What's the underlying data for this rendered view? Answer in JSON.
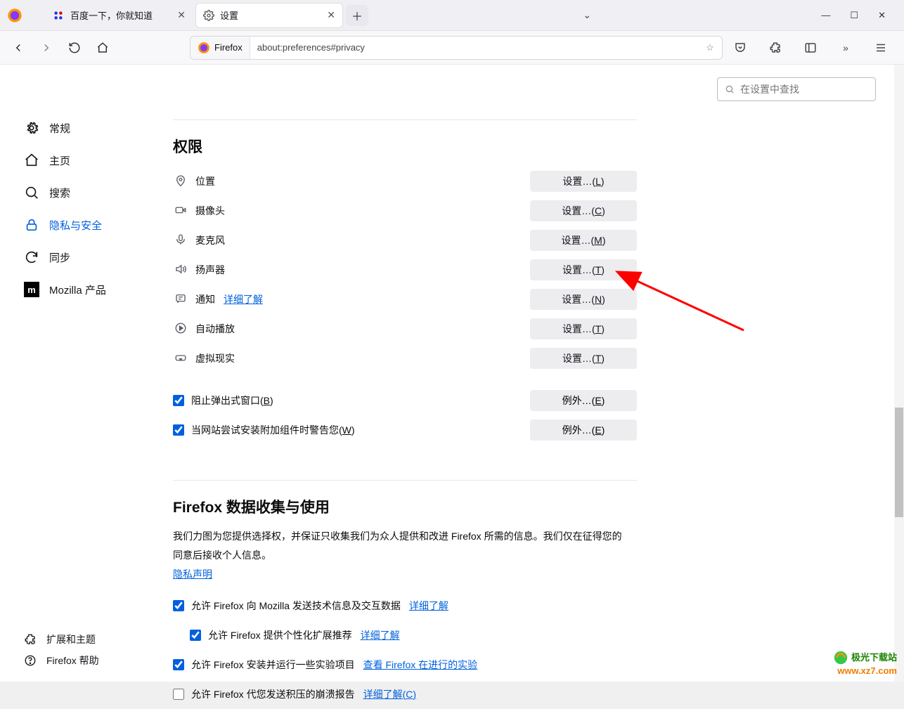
{
  "tabs": {
    "tab0": {
      "label": "百度一下，你就知道"
    },
    "tab1": {
      "label": "设置"
    }
  },
  "urlbar": {
    "chip": "Firefox",
    "url": "about:preferences#privacy"
  },
  "search": {
    "placeholder": "在设置中查找"
  },
  "sidebar": {
    "general": "常规",
    "home": "主页",
    "search": "搜索",
    "privacy": "隐私与安全",
    "sync": "同步",
    "mozilla": "Mozilla 产品",
    "extensions": "扩展和主题",
    "help": "Firefox 帮助"
  },
  "permissions": {
    "title": "权限",
    "location": "位置",
    "camera": "摄像头",
    "microphone": "麦克风",
    "speaker": "扬声器",
    "notifications": "通知",
    "autoplay": "自动播放",
    "vr": "虚拟现实",
    "learn_more": "详细了解",
    "btn_prefix": "设置…(",
    "exc_prefix": "例外…(",
    "btn_suffix": ")",
    "hk_l": "L",
    "hk_c": "C",
    "hk_m": "M",
    "hk_t": "T",
    "hk_n": "N",
    "hk_e": "E",
    "popup_pre": "阻止弹出式窗口(",
    "popup_hk": "B",
    "addon_pre": "当网站尝试安装附加组件时警告您(",
    "addon_hk": "W"
  },
  "datacollect": {
    "title": "Firefox 数据收集与使用",
    "p1": "我们力图为您提供选择权，并保证只收集我们为众人提供和改进 Firefox 所需的信息。我们仅在征得您的同意后接收个人信息。",
    "privacy_link": "隐私声明",
    "c1": "允许 Firefox 向 Mozilla 发送技术信息及交互数据",
    "c1_link": "详细了解",
    "c2": "允许 Firefox 提供个性化扩展推荐",
    "c2_link": "详细了解",
    "c3": "允许 Firefox 安装并运行一些实验项目",
    "c3_link": "查看 Firefox 在进行的实验",
    "c4_pre": "允许 Firefox 代您发送积压的崩溃报告",
    "c4_link": "详细了解(",
    "c4_hk": "C",
    "c4_link_suffix": ")"
  },
  "watermark": {
    "l1": "极光下载站",
    "l2": "www.xz7.com"
  }
}
